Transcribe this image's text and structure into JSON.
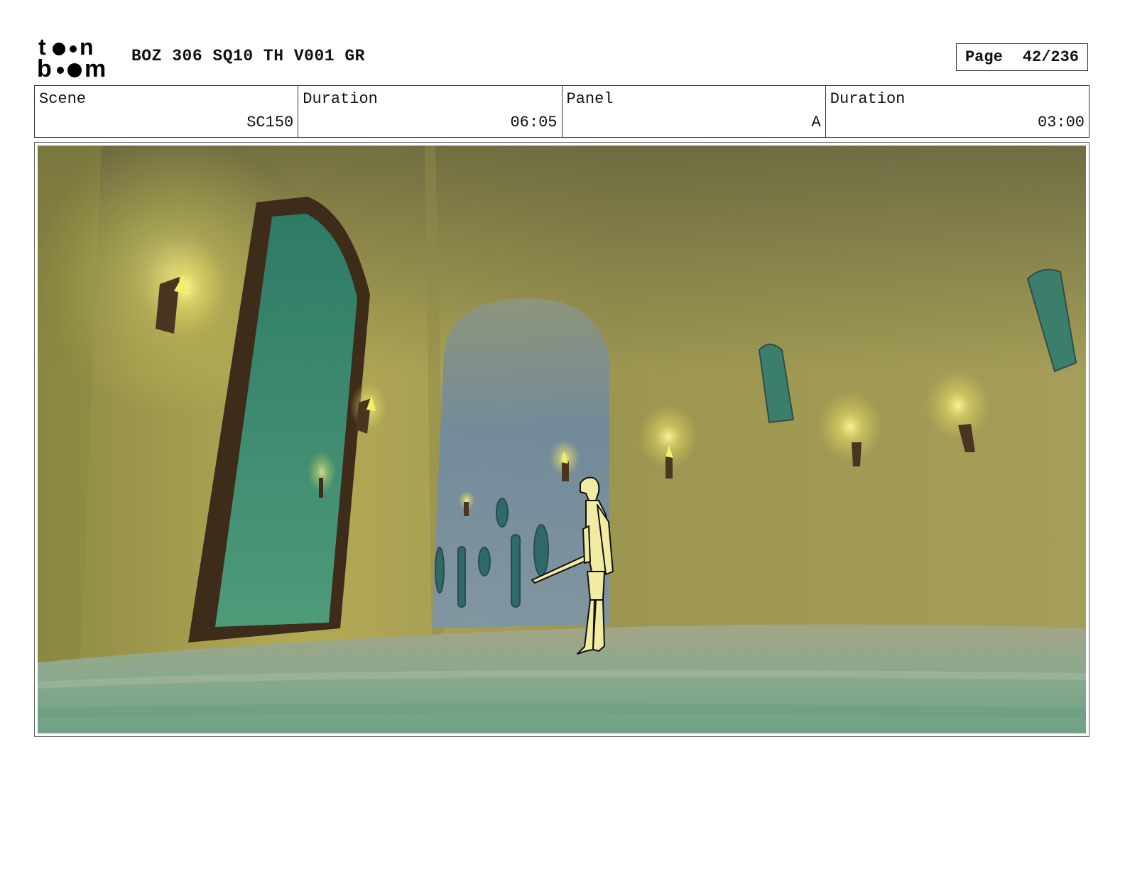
{
  "header": {
    "logo_top": "to●n",
    "logo_bottom": "b●●m",
    "title": "BOZ 306 SQ10 TH V001 GR",
    "page_label": "Page",
    "page_value": "42/236"
  },
  "info": {
    "scene_label": "Scene",
    "scene_value": "SC150",
    "scene_duration_label": "Duration",
    "scene_duration_value": "06:05",
    "panel_label": "Panel",
    "panel_value": "A",
    "panel_duration_label": "Duration",
    "panel_duration_value": "03:00"
  },
  "colors": {
    "wall": "#a8a04e",
    "floor": "#7fa58a",
    "door_glass": "#3f8a70",
    "door_frame": "#4a3520",
    "torch_flame": "#f3ef6a",
    "corridor": "#6f8aa0",
    "character_fill": "#f2eba2"
  }
}
